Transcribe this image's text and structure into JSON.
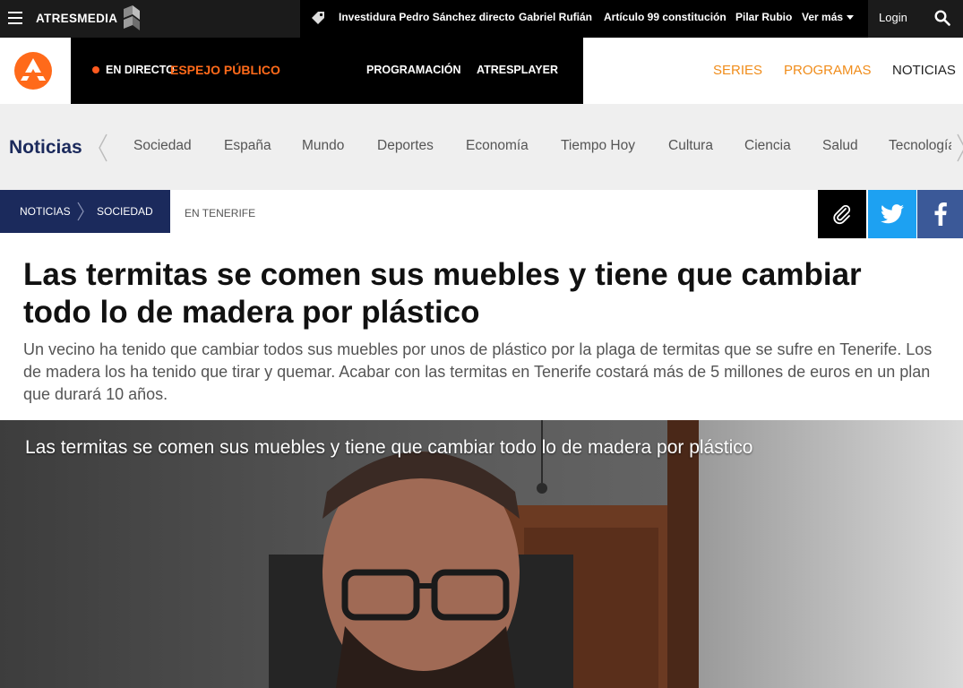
{
  "topbar": {
    "brand": "ATRESMEDIA",
    "trending": [
      "Investidura Pedro Sánchez directo",
      "Gabriel Rufián",
      "Artículo 99 constitución",
      "Pilar Rubio"
    ],
    "more_label": "Ver más",
    "login_label": "Login"
  },
  "channel": {
    "live_label": "EN DIRECTO",
    "live_show": "ESPEJO PÚBLICO",
    "links": [
      "PROGRAMACIÓN",
      "ATRESPLAYER"
    ],
    "right_links": [
      "SERIES",
      "PROGRAMAS",
      "NOTICIAS"
    ],
    "accent_color": "#f08c1a",
    "live_color": "#ff6a1a"
  },
  "section_nav": {
    "title": "Noticias",
    "items": [
      "Sociedad",
      "España",
      "Mundo",
      "Deportes",
      "Economía",
      "Tiempo Hoy",
      "Cultura",
      "Ciencia",
      "Salud",
      "Tecnología"
    ]
  },
  "breadcrumb": {
    "items": [
      "NOTICIAS",
      "SOCIEDAD"
    ],
    "tag": "EN TENERIFE",
    "brand_color": "#1b2a5c"
  },
  "share": {
    "icons": [
      "paperclip-icon",
      "twitter-icon",
      "facebook-icon"
    ],
    "twitter_color": "#1da1f2",
    "facebook_color": "#3b5998"
  },
  "article": {
    "headline": "Las termitas se comen sus muebles y tiene que cambiar todo lo de madera por plástico",
    "lede": "Un vecino ha tenido que cambiar todos sus muebles por unos de plástico por la plaga de termitas que se sufre en Tenerife. Los de madera los ha tenido que tirar y quemar. Acabar con las termitas en Tenerife costará más de 5 millones de euros en un plan que durará 10 años.",
    "video_caption": "Las termitas se comen sus muebles y tiene que cambiar todo lo de madera por plástico"
  }
}
